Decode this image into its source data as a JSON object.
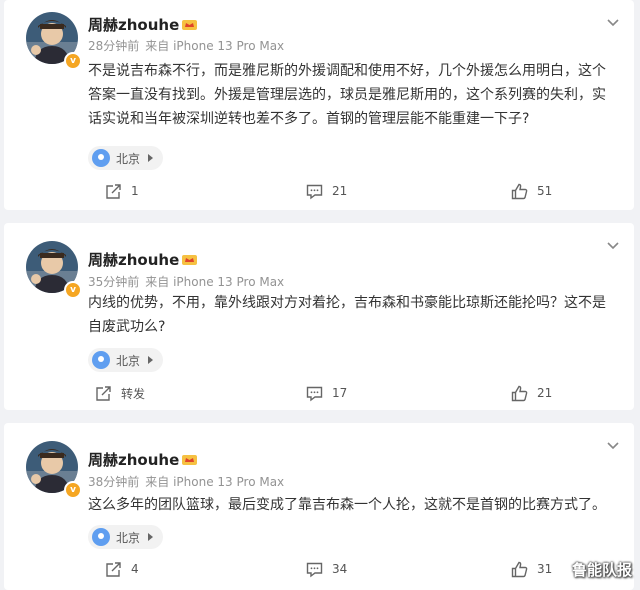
{
  "posts": [
    {
      "username": "周赫zhouhe",
      "time": "28分钟前",
      "source": "来自 iPhone 13 Pro Max",
      "content": "不是说吉布森不行，而是雅尼斯的外援调配和使用不好，几个外援怎么用明白，这个答案一直没有找到。外援是管理层选的，球员是雅尼斯用的，这个系列赛的失利，实话实说和当年被深圳逆转也差不多了。首钢的管理层能不能重建一下子?",
      "location": "北京",
      "share_label": "1",
      "comment_count": "21",
      "like_count": "51"
    },
    {
      "username": "周赫zhouhe",
      "time": "35分钟前",
      "source": "来自 iPhone 13 Pro Max",
      "content": "内线的优势，不用，靠外线跟对方对着抡，吉布森和书豪能比琼斯还能抡吗？这不是自废武功么?",
      "location": "北京",
      "share_label": "转发",
      "comment_count": "17",
      "like_count": "21"
    },
    {
      "username": "周赫zhouhe",
      "time": "38分钟前",
      "source": "来自 iPhone 13 Pro Max",
      "content": "这么多年的团队篮球，最后变成了靠吉布森一个人抡，这就不是首钢的比赛方式了。",
      "location": "北京",
      "share_label": "4",
      "comment_count": "34",
      "like_count": "31"
    }
  ],
  "watermark": "鲁能队报",
  "colors": {
    "accent_badge": "#f5a623",
    "pin": "#5f9ef0",
    "background": "#f1f2f5"
  }
}
